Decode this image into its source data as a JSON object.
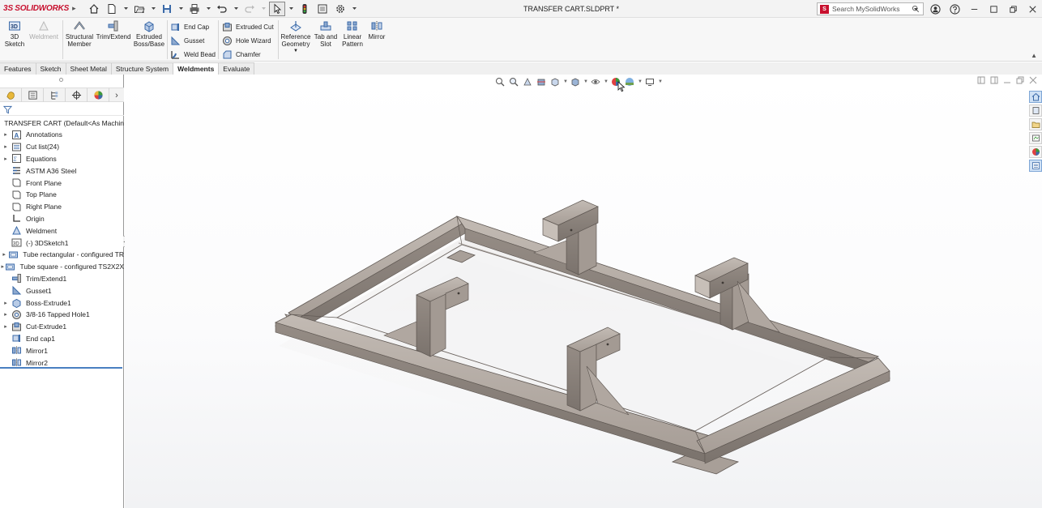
{
  "app": {
    "brand_prefix": "3S",
    "brand_name": "SOLIDWORKS",
    "document_title": "TRANSFER CART.SLDPRT *",
    "search_placeholder": "Search MySolidWorks",
    "search_badge": "S"
  },
  "commands": {
    "sketch3d_label": "3D",
    "sketch3d_label2": "Sketch",
    "weldment_label": "Weldment",
    "structural_member_label": "Structural",
    "structural_member_label2": "Member",
    "trim_extend_label": "Trim/Extend",
    "extruded_boss_label": "Extruded",
    "extruded_boss_label2": "Boss/Base",
    "end_cap_label": "End Cap",
    "gusset_label": "Gusset",
    "weld_bead_label": "Weld Bead",
    "extruded_cut_label": "Extruded Cut",
    "hole_wizard_label": "Hole Wizard",
    "chamfer_label": "Chamfer",
    "reference_geometry_label": "Reference",
    "reference_geometry_label2": "Geometry",
    "tab_slot_label": "Tab and",
    "tab_slot_label2": "Slot",
    "linear_pattern_label": "Linear",
    "linear_pattern_label2": "Pattern",
    "mirror_label": "Mirror"
  },
  "tabs": [
    {
      "label": "Features"
    },
    {
      "label": "Sketch"
    },
    {
      "label": "Sheet Metal"
    },
    {
      "label": "Structure System"
    },
    {
      "label": "Weldments",
      "active": true
    },
    {
      "label": "Evaluate"
    }
  ],
  "feature_tree": {
    "root": "TRANSFER CART  (Default<As Machin",
    "items": [
      {
        "label": "Annotations",
        "expandable": true,
        "icon": "annotations-icon"
      },
      {
        "label": "Cut list(24)",
        "expandable": true,
        "icon": "cut-list-icon"
      },
      {
        "label": "Equations",
        "expandable": true,
        "icon": "equations-icon"
      },
      {
        "label": "ASTM A36 Steel",
        "expandable": false,
        "icon": "material-icon"
      },
      {
        "label": "Front Plane",
        "expandable": false,
        "icon": "plane-icon"
      },
      {
        "label": "Top Plane",
        "expandable": false,
        "icon": "plane-icon"
      },
      {
        "label": "Right Plane",
        "expandable": false,
        "icon": "plane-icon"
      },
      {
        "label": "Origin",
        "expandable": false,
        "icon": "origin-icon"
      },
      {
        "label": "Weldment",
        "expandable": false,
        "icon": "weldment-icon"
      },
      {
        "label": "(-) 3DSketch1",
        "expandable": false,
        "icon": "sketch3d-icon"
      },
      {
        "label": "Tube rectangular - configured TR",
        "expandable": true,
        "icon": "structural-member-icon"
      },
      {
        "label": "Tube square - configured TS2X2X",
        "expandable": true,
        "icon": "structural-member-icon"
      },
      {
        "label": "Trim/Extend1",
        "expandable": false,
        "icon": "trim-icon"
      },
      {
        "label": "Gusset1",
        "expandable": false,
        "icon": "gusset-icon"
      },
      {
        "label": "Boss-Extrude1",
        "expandable": true,
        "icon": "extrude-icon"
      },
      {
        "label": "3/8-16 Tapped Hole1",
        "expandable": true,
        "icon": "hole-icon"
      },
      {
        "label": "Cut-Extrude1",
        "expandable": true,
        "icon": "cut-icon"
      },
      {
        "label": "End cap1",
        "expandable": false,
        "icon": "endcap-icon"
      },
      {
        "label": "Mirror1",
        "expandable": false,
        "icon": "mirror-icon"
      },
      {
        "label": "Mirror2",
        "expandable": false,
        "icon": "mirror-icon"
      }
    ]
  },
  "colors": {
    "brand": "#c8102e",
    "steel_top": "#b7aea7",
    "steel_side": "#8f8680",
    "steel_dark": "#6e6661",
    "accent_blue": "#4a7fc1"
  }
}
